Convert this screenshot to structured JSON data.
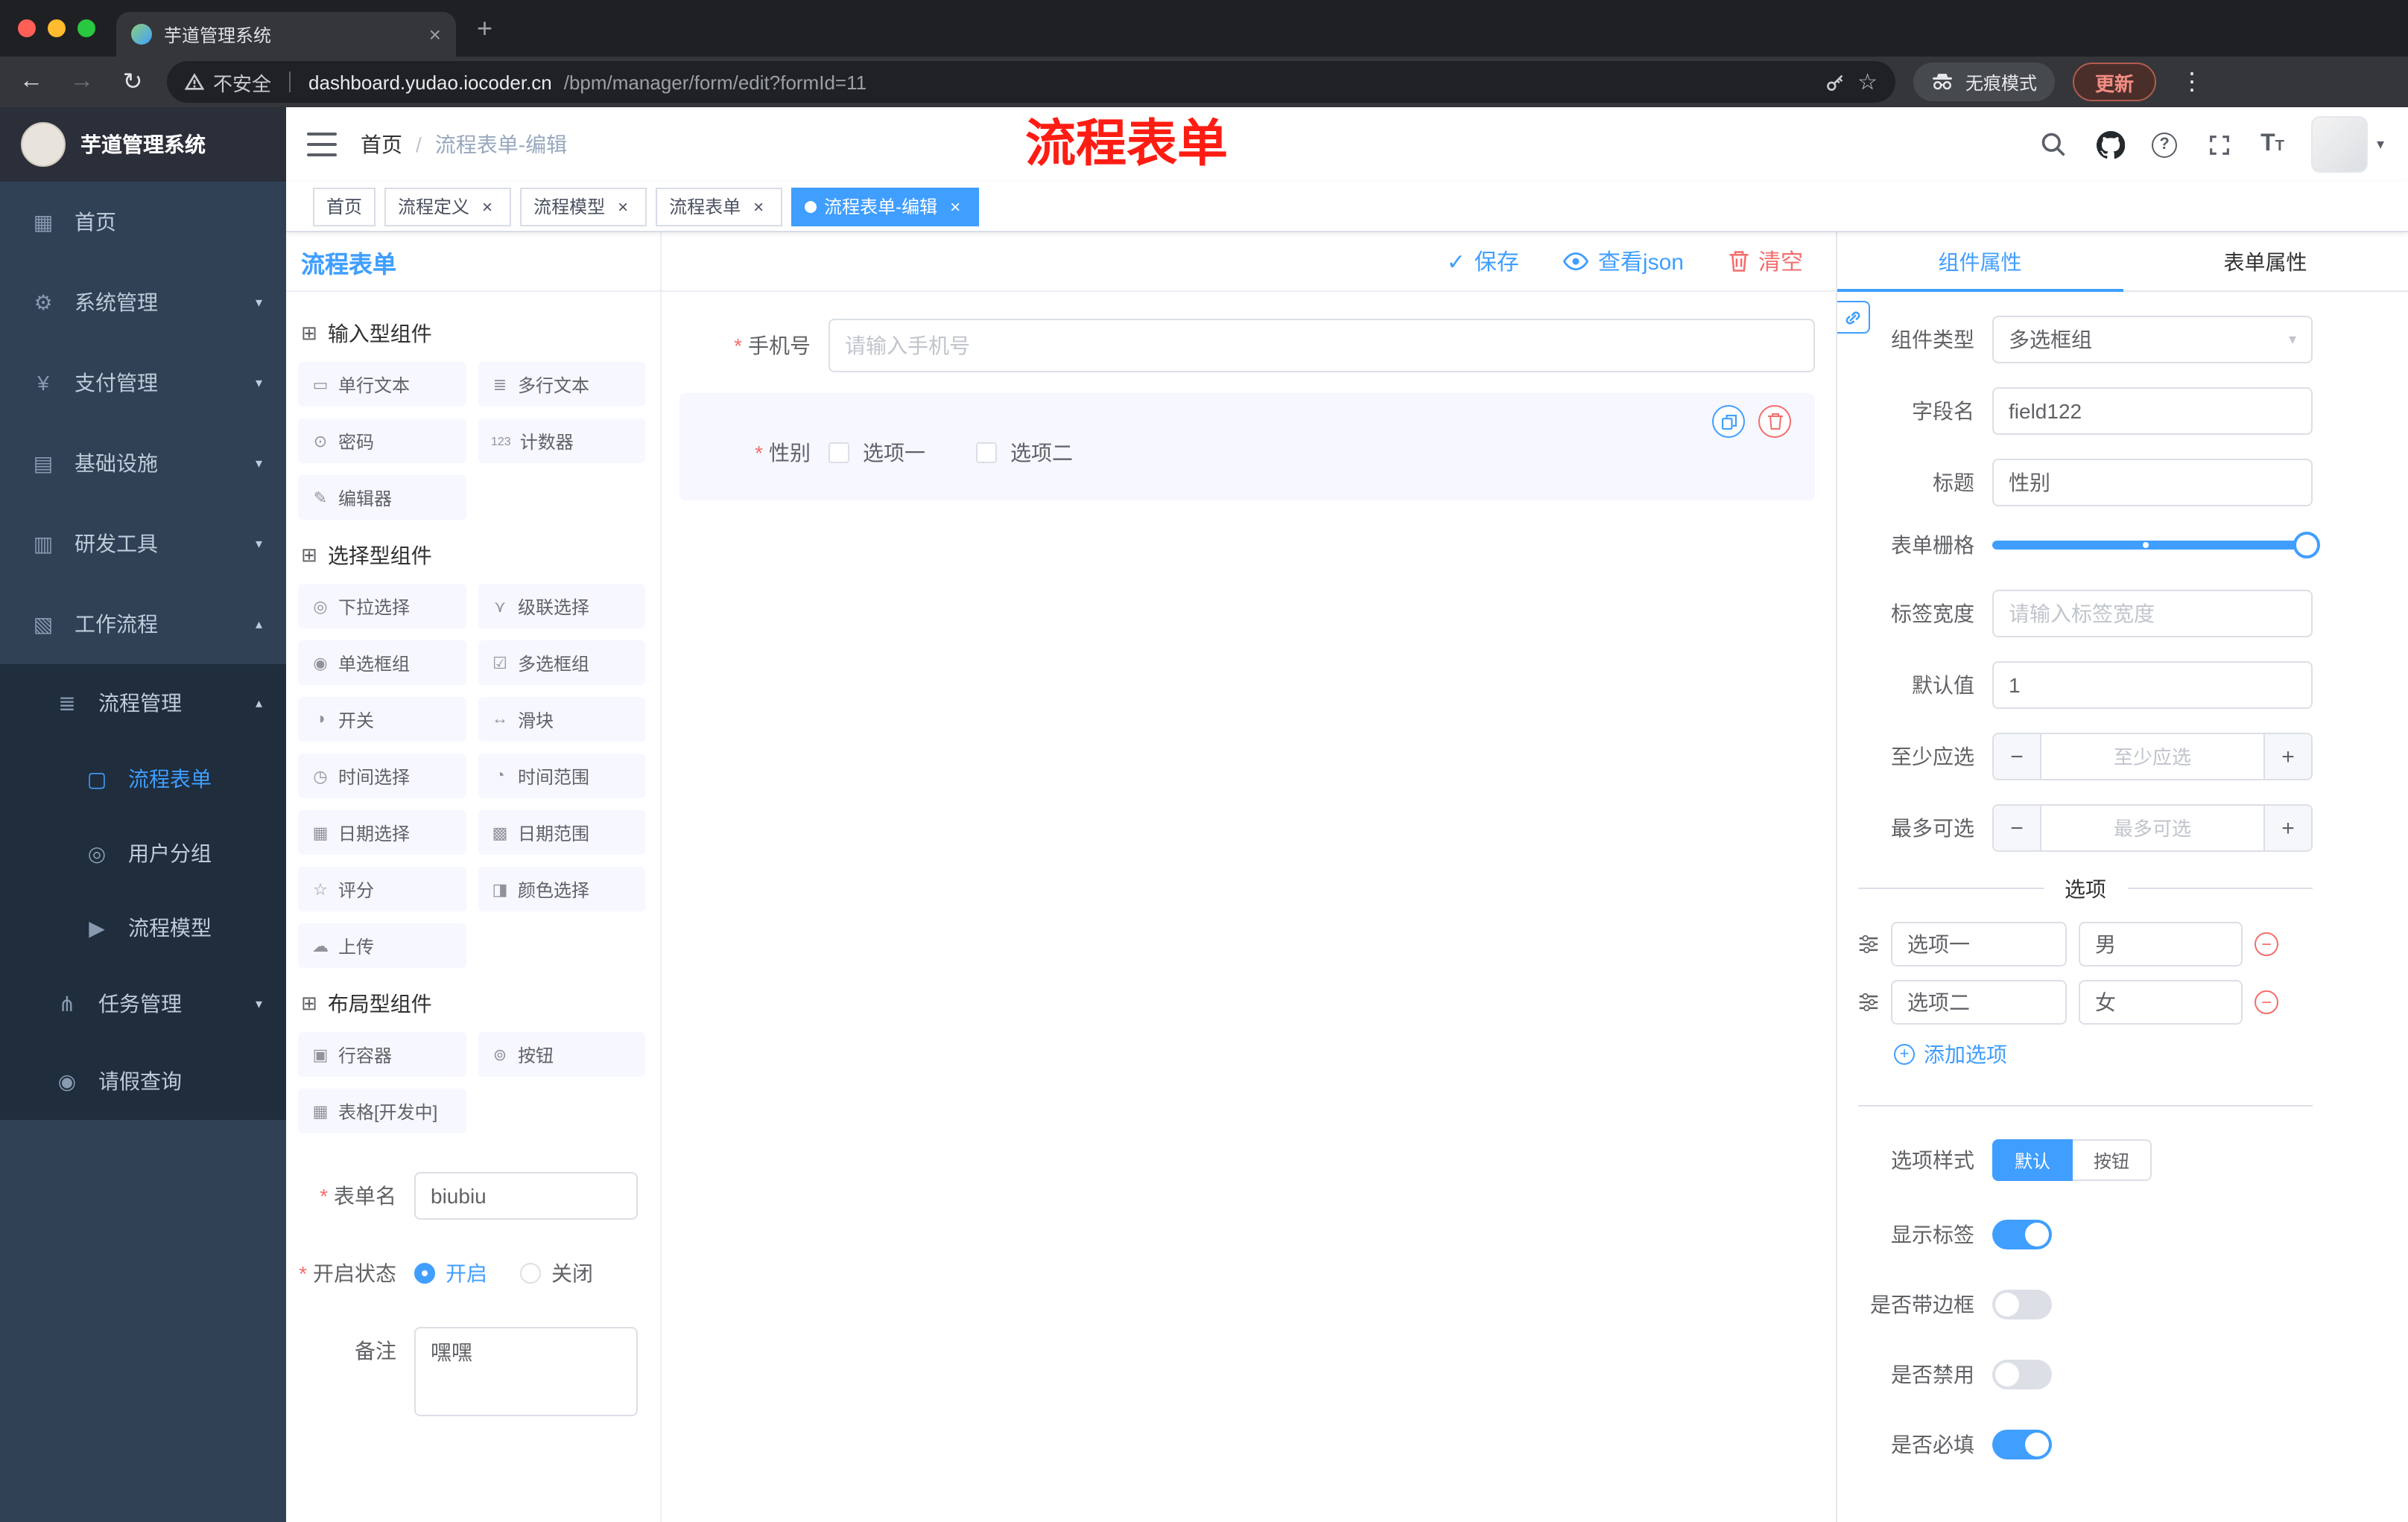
{
  "browser": {
    "tab": {
      "title": "芋道管理系统"
    },
    "toolbar": {
      "security": "不安全",
      "url_host": "dashboard.yudao.iocoder.cn",
      "url_path": "/bpm/manager/form/edit?formId=11",
      "incognito": "无痕模式",
      "update": "更新"
    }
  },
  "sidebar": {
    "logo": "芋道管理系统",
    "items": [
      {
        "icon": "▦",
        "label": "首页"
      },
      {
        "icon": "⚙",
        "label": "系统管理",
        "arrow": "▾"
      },
      {
        "icon": "¥",
        "label": "支付管理",
        "arrow": "▾"
      },
      {
        "icon": "▤",
        "label": "基础设施",
        "arrow": "▾"
      },
      {
        "icon": "▥",
        "label": "研发工具",
        "arrow": "▾"
      },
      {
        "icon": "▧",
        "label": "工作流程",
        "arrow": "▴"
      },
      {
        "icon": "≣",
        "label": "流程管理",
        "arrow": "▴"
      },
      {
        "icon": "▢",
        "label": "流程表单"
      },
      {
        "icon": "◎",
        "label": "用户分组"
      },
      {
        "icon": "▶",
        "label": "流程模型"
      },
      {
        "icon": "⋔",
        "label": "任务管理",
        "arrow": "▾"
      },
      {
        "icon": "◉",
        "label": "请假查询"
      }
    ]
  },
  "header": {
    "breadcrumb_root": "首页",
    "breadcrumb_sep": "/",
    "breadcrumb_current": "流程表单-编辑",
    "annotation": "流程表单"
  },
  "tags": [
    {
      "label": "首页"
    },
    {
      "label": "流程定义"
    },
    {
      "label": "流程模型"
    },
    {
      "label": "流程表单"
    },
    {
      "label": "流程表单-编辑"
    }
  ],
  "palette": {
    "title": "流程表单",
    "groups": [
      {
        "icon": "⊞",
        "title": "输入型组件",
        "items": [
          {
            "icon": "▭",
            "label": "单行文本"
          },
          {
            "icon": "≣",
            "label": "多行文本"
          },
          {
            "icon": "⊙",
            "label": "密码"
          },
          {
            "icon": "123",
            "label": "计数器"
          },
          {
            "icon": "✎",
            "label": "编辑器"
          }
        ]
      },
      {
        "icon": "⊞",
        "title": "选择型组件",
        "items": [
          {
            "icon": "◎",
            "label": "下拉选择"
          },
          {
            "icon": "⋎",
            "label": "级联选择"
          },
          {
            "icon": "◉",
            "label": "单选框组"
          },
          {
            "icon": "☑",
            "label": "多选框组"
          },
          {
            "icon": "◑",
            "label": "开关"
          },
          {
            "icon": "↔",
            "label": "滑块"
          },
          {
            "icon": "◷",
            "label": "时间选择"
          },
          {
            "icon": "◔",
            "label": "时间范围"
          },
          {
            "icon": "▦",
            "label": "日期选择"
          },
          {
            "icon": "▩",
            "label": "日期范围"
          },
          {
            "icon": "☆",
            "label": "评分"
          },
          {
            "icon": "◨",
            "label": "颜色选择"
          },
          {
            "icon": "☁",
            "label": "上传"
          }
        ]
      },
      {
        "icon": "⊞",
        "title": "布局型组件",
        "items": [
          {
            "icon": "▣",
            "label": "行容器"
          },
          {
            "icon": "⊚",
            "label": "按钮"
          },
          {
            "icon": "▦",
            "label": "表格[开发中]"
          }
        ]
      }
    ],
    "meta": {
      "name_label": "表单名",
      "name_value": "biubiu",
      "status_label": "开启状态",
      "status_on": "开启",
      "status_off": "关闭",
      "remark_label": "备注",
      "remark_value": "嘿嘿"
    }
  },
  "canvas": {
    "actions": {
      "save": "保存",
      "view_json": "查看json",
      "clear": "清空"
    },
    "phone_label": "手机号",
    "phone_placeholder": "请输入手机号",
    "gender_label": "性别",
    "gender_opt1": "选项一",
    "gender_opt2": "选项二"
  },
  "props": {
    "tab_component": "组件属性",
    "tab_form": "表单属性",
    "rows": {
      "type_label": "组件类型",
      "type_value": "多选框组",
      "field_label": "字段名",
      "field_value": "field122",
      "title_label": "标题",
      "title_value": "性别",
      "grid_label": "表单栅格",
      "width_label": "标签宽度",
      "width_placeholder": "请输入标签宽度",
      "default_label": "默认值",
      "default_value": "1",
      "min_label": "至少应选",
      "min_placeholder": "至少应选",
      "max_label": "最多可选",
      "max_placeholder": "最多可选",
      "minus": "−",
      "plus": "+"
    },
    "options": {
      "divider": "选项",
      "rows": [
        {
          "name": "选项一",
          "value": "男"
        },
        {
          "name": "选项二",
          "value": "女"
        }
      ],
      "add": "添加选项"
    },
    "style": {
      "label": "选项样式",
      "default": "默认",
      "button": "按钮"
    },
    "switches": [
      {
        "label": "显示标签"
      },
      {
        "label": "是否带边框"
      },
      {
        "label": "是否禁用"
      },
      {
        "label": "是否必填"
      }
    ]
  },
  "colors": {
    "primary": "#409EFF",
    "danger": "#F56C6C",
    "annotation": "#FF0000",
    "sidebar": "#304156"
  }
}
